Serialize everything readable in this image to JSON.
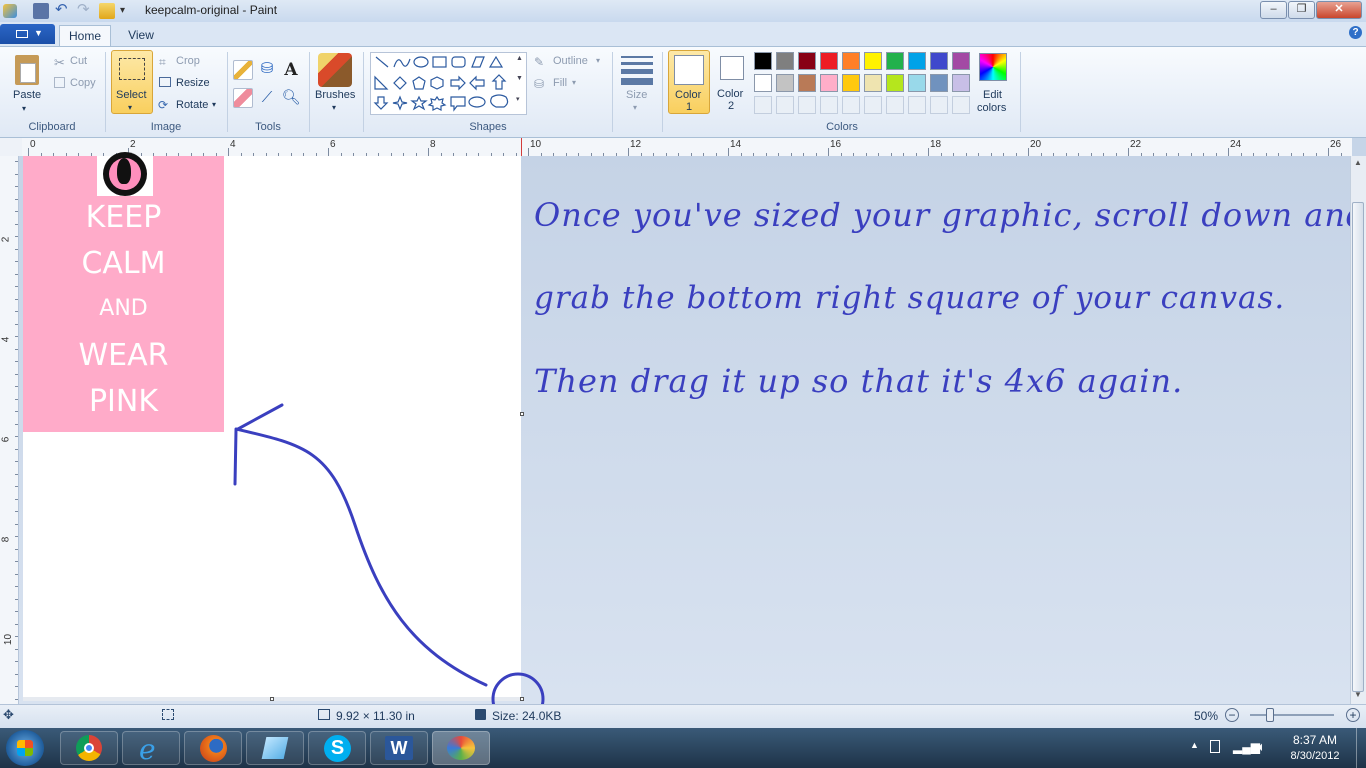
{
  "window": {
    "title": "keepcalm-original - Paint"
  },
  "tabs": {
    "home": "Home",
    "view": "View"
  },
  "clipboard": {
    "paste": "Paste",
    "cut": "Cut",
    "copy": "Copy",
    "group": "Clipboard"
  },
  "image": {
    "select": "Select",
    "crop": "Crop",
    "resize": "Resize",
    "rotate": "Rotate",
    "group": "Image"
  },
  "tools": {
    "group": "Tools",
    "text_tool_glyph": "A"
  },
  "brushes": {
    "label": "Brushes"
  },
  "shapes": {
    "group": "Shapes",
    "outline": "Outline",
    "fill": "Fill"
  },
  "size": {
    "label": "Size"
  },
  "colors": {
    "color1_line1": "Color",
    "color1_line2": "1",
    "color2_line1": "Color",
    "color2_line2": "2",
    "edit_line1": "Edit",
    "edit_line2": "colors",
    "group": "Colors",
    "palette_row1": [
      "#000000",
      "#7f7f7f",
      "#880015",
      "#ed1c24",
      "#ff7f27",
      "#fff200",
      "#22b14c",
      "#00a2e8",
      "#3f48cc",
      "#a349a4"
    ],
    "palette_row2": [
      "#ffffff",
      "#c3c3c3",
      "#b97a57",
      "#ffaec9",
      "#ffc90e",
      "#efe4b0",
      "#b5e61d",
      "#99d9ea",
      "#7092be",
      "#c8bfe7"
    ]
  },
  "ruler": {
    "h": [
      "0",
      "2",
      "4",
      "6",
      "8",
      "10",
      "12",
      "14",
      "16",
      "18",
      "20",
      "22",
      "24",
      "26"
    ],
    "v": [
      "2",
      "4",
      "6",
      "8",
      "10"
    ]
  },
  "poster": {
    "l1": "KEEP",
    "l2": "CALM",
    "l3": "AND",
    "l4": "WEAR",
    "l5": "PINK"
  },
  "annotation": {
    "line1": "Once you've sized your graphic, scroll down and",
    "line2": "grab the bottom right square of your canvas.",
    "line3": "Then drag it up so that it's 4x6 again."
  },
  "status": {
    "dimensions": "9.92 × 11.30 in",
    "size": "Size: 24.0KB",
    "zoom": "50%"
  },
  "clock": {
    "time": "8:37 AM",
    "date": "8/30/2012"
  }
}
